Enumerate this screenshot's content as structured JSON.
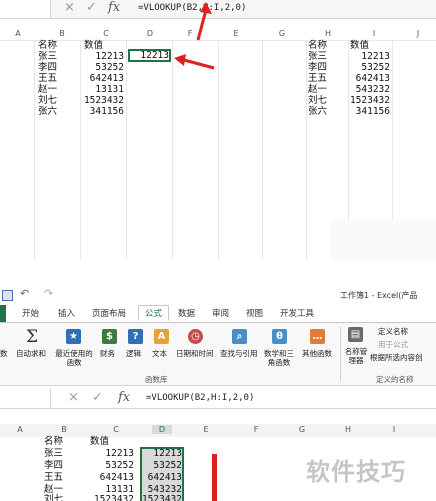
{
  "top_sheet": {
    "formula_bar": {
      "cancel_icon": "×",
      "enter_icon": "✓",
      "fx_label": "fx",
      "formula": "=VLOOKUP(B2,H:I,2,0)"
    },
    "columns": [
      "A",
      "B",
      "C",
      "D",
      "E",
      "F",
      "G",
      "H",
      "I",
      "J"
    ],
    "left_table": {
      "headers": [
        "名称",
        "数值"
      ],
      "rows": [
        [
          "张三",
          "12213"
        ],
        [
          "李四",
          "53252"
        ],
        [
          "王五",
          "642413"
        ],
        [
          "赵一",
          "13131"
        ],
        [
          "刘七",
          "1523432"
        ],
        [
          "张六",
          "341156"
        ]
      ]
    },
    "active_cell_value": "12213",
    "right_table": {
      "headers": [
        "名称",
        "数值"
      ],
      "rows": [
        [
          "张三",
          "12213"
        ],
        [
          "李四",
          "53252"
        ],
        [
          "王五",
          "642413"
        ],
        [
          "赵一",
          "543232"
        ],
        [
          "刘七",
          "1523432"
        ],
        [
          "张六",
          "341156"
        ]
      ]
    }
  },
  "ribbon": {
    "quick_access": {
      "save_icon": "save-icon",
      "undo": "↶",
      "redo": "↷"
    },
    "title": "工作簿1 - Excel(产品",
    "tabs": [
      "开始",
      "插入",
      "页面布局",
      "公式",
      "数据",
      "审阅",
      "视图",
      "开发工具"
    ],
    "active_tab": "公式",
    "buttons": {
      "insert_fn": "数",
      "autosum": "自动求和",
      "recent": "最近使用的函数",
      "finance": "财务",
      "logic": "逻辑",
      "text": "文本",
      "datetime": "日期和时间",
      "lookup": "查找与引用",
      "math": "数学和三角函数",
      "more": "其他函数",
      "name_mgr": "名称管理器",
      "define_name": "定义名称",
      "use_in_formula": "用于公式",
      "create_from_sel": "根据所选内容创",
      "group_library": "函数库",
      "group_names": "定义的名称"
    }
  },
  "bottom_sheet": {
    "formula_bar": {
      "formula": "=VLOOKUP(B2,H:I,2,0)",
      "fx_label": "fx"
    },
    "columns": [
      "A",
      "B",
      "C",
      "D",
      "E",
      "F",
      "G",
      "H",
      "I"
    ],
    "headers": [
      "名称",
      "数值"
    ],
    "rows": [
      [
        "张三",
        "12213",
        "12213"
      ],
      [
        "李四",
        "53252",
        "53252"
      ],
      [
        "王五",
        "642413",
        "642413"
      ],
      [
        "赵一",
        "13131",
        "543232"
      ],
      [
        "刘七",
        "1523432",
        "1523432"
      ]
    ]
  },
  "watermark": "软件技巧",
  "colors": {
    "accent": "#217346",
    "arrow": "#e02020",
    "selection": "#d9d9d9"
  }
}
